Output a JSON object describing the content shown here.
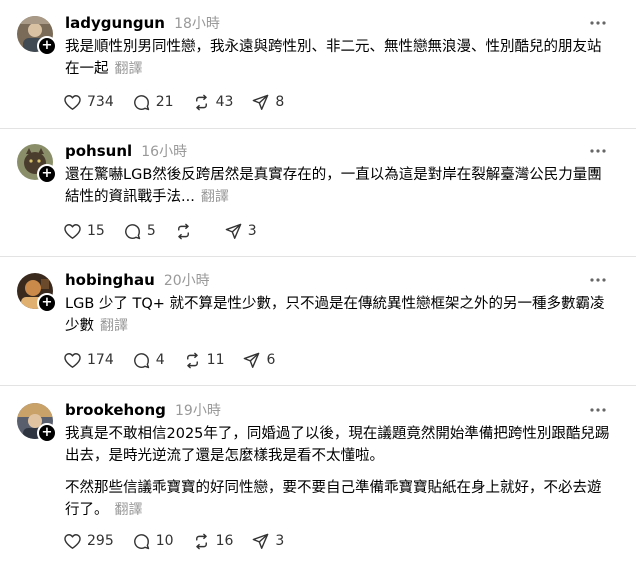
{
  "posts": [
    {
      "username": "ladygungun",
      "time": "18小時",
      "paragraphs": [
        "我是順性別男同性戀，我永遠與跨性別、非二元、無性戀無浪漫、性別酷兒的朋友站在一起"
      ],
      "translate": "翻譯",
      "likes": "734",
      "comments": "21",
      "reposts": "43",
      "shares": "8"
    },
    {
      "username": "pohsunl",
      "time": "16小時",
      "paragraphs": [
        "還在驚嚇LGB然後反跨居然是真實存在的，一直以為這是對岸在裂解臺灣公民力量團結性的資訊戰手法..."
      ],
      "translate": "翻譯",
      "likes": "15",
      "comments": "5",
      "reposts": "",
      "shares": "3"
    },
    {
      "username": "hobinghau",
      "time": "20小時",
      "paragraphs": [
        "LGB 少了 TQ+ 就不算是性少數，只不過是在傳統異性戀框架之外的另一種多數霸凌少數"
      ],
      "translate": "翻譯",
      "likes": "174",
      "comments": "4",
      "reposts": "11",
      "shares": "6"
    },
    {
      "username": "brookehong",
      "time": "19小時",
      "paragraphs": [
        "我真是不敢相信2025年了，同婚過了以後，現在議題竟然開始準備把跨性別跟酷兒踢出去，是時光逆流了還是怎麼樣我是看不太懂啦。",
        "不然那些信議乖寶寶的好同性戀，要不要自己準備乖寶寶貼紙在身上就好，不必去遊行了。"
      ],
      "translate": "翻譯",
      "likes": "295",
      "comments": "10",
      "reposts": "16",
      "shares": "3"
    }
  ],
  "colors": {
    "muted": "#999999",
    "divider": "#e3e3e3",
    "text": "#000000"
  },
  "icons": [
    "heart-icon",
    "comment-icon",
    "repost-icon",
    "share-icon",
    "more-icon",
    "follow-plus-icon"
  ]
}
